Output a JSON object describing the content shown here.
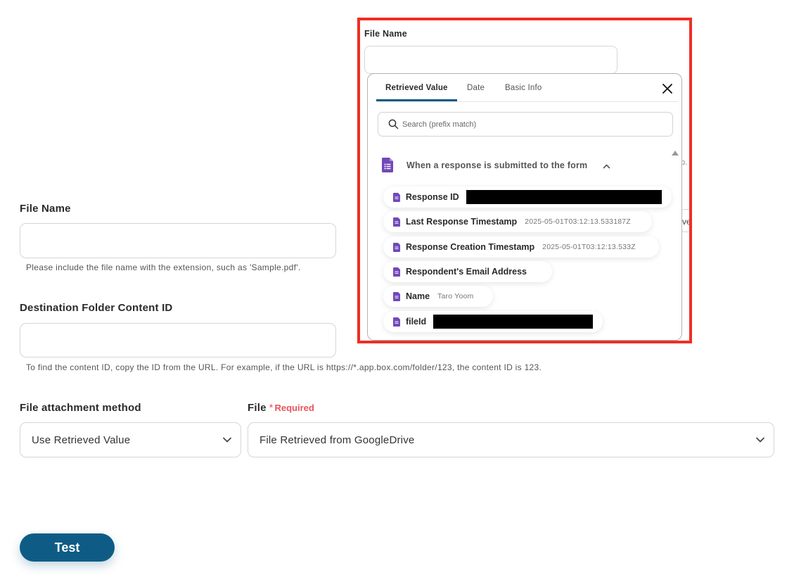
{
  "form": {
    "file_name_label": "File Name",
    "file_name_value": "",
    "file_name_help": "Please include the file name with the extension, such as 'Sample.pdf'.",
    "dest_folder_label": "Destination Folder Content ID",
    "dest_folder_value": "",
    "dest_folder_help": "To find the content ID, copy the ID from the URL. For example, if the URL is https://*.app.box.com/folder/123, the content ID is 123.",
    "attach_method_label": "File attachment method",
    "attach_method_value": "Use Retrieved Value",
    "file_label": "File",
    "required_star": "*",
    "required_text": "Required",
    "file_value": "File Retrieved from GoogleDrive",
    "test_button": "Test"
  },
  "popup": {
    "file_name_label": "File Name",
    "tabs": [
      {
        "label": "Retrieved Value",
        "active": true
      },
      {
        "label": "Date",
        "active": false
      },
      {
        "label": "Basic Info",
        "active": false
      }
    ],
    "search_placeholder": "Search (prefix match)",
    "section_title": "When a response is submitted to the form",
    "items": [
      {
        "label": "Response ID",
        "value": "",
        "redacted": true
      },
      {
        "label": "Last Response Timestamp",
        "value": "2025-05-01T03:12:13.533187Z",
        "redacted": false
      },
      {
        "label": "Response Creation Timestamp",
        "value": "2025-05-01T03:12:13.533Z",
        "redacted": false
      },
      {
        "label": "Respondent's Email Address",
        "value": "",
        "redacted": false
      },
      {
        "label": "Name",
        "value": "Taro Yoom",
        "redacted": false
      },
      {
        "label": "fileId",
        "value": "",
        "redacted": true
      }
    ],
    "peek_text_1": "p.",
    "peek_text_2": "ve"
  },
  "colors": {
    "accent": "#0e5c86",
    "highlight": "#ef2e24",
    "forms_purple": "#7248b9",
    "required": "#e8555c"
  },
  "icons": {
    "close": "close-icon",
    "search": "search-icon",
    "section": "google-forms-icon",
    "item": "form-doc-icon",
    "chevron": "chevron-down-icon",
    "collapse": "chevron-up-icon"
  }
}
